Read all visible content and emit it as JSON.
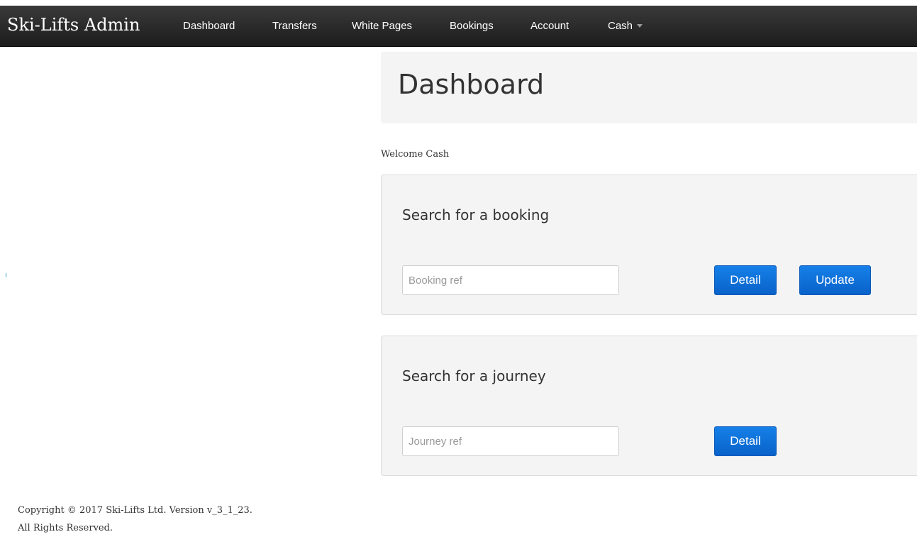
{
  "navbar": {
    "brand": "Ski-Lifts Admin",
    "items": [
      {
        "label": "Dashboard"
      },
      {
        "label": "Transfers"
      },
      {
        "label": "White Pages"
      },
      {
        "label": "Bookings"
      },
      {
        "label": "Account"
      }
    ],
    "user_menu": {
      "label": "Cash",
      "icon": "caret-down-icon"
    }
  },
  "header": {
    "title": "Dashboard"
  },
  "welcome_text": "Welcome Cash",
  "booking_search": {
    "title": "Search for a booking",
    "input_placeholder": "Booking ref",
    "input_value": "",
    "detail_label": "Detail",
    "update_label": "Update"
  },
  "journey_search": {
    "title": "Search for a journey",
    "input_placeholder": "Journey ref",
    "input_value": "",
    "detail_label": "Detail"
  },
  "footer": {
    "copyright": "Copyright © 2017 Ski-Lifts Ltd. Version v_3_1_23.",
    "rights": "All Rights Reserved."
  },
  "colors": {
    "navbar_bg": "#222222",
    "panel_bg": "#f4f4f4",
    "button_primary": "#0d6fd9"
  }
}
